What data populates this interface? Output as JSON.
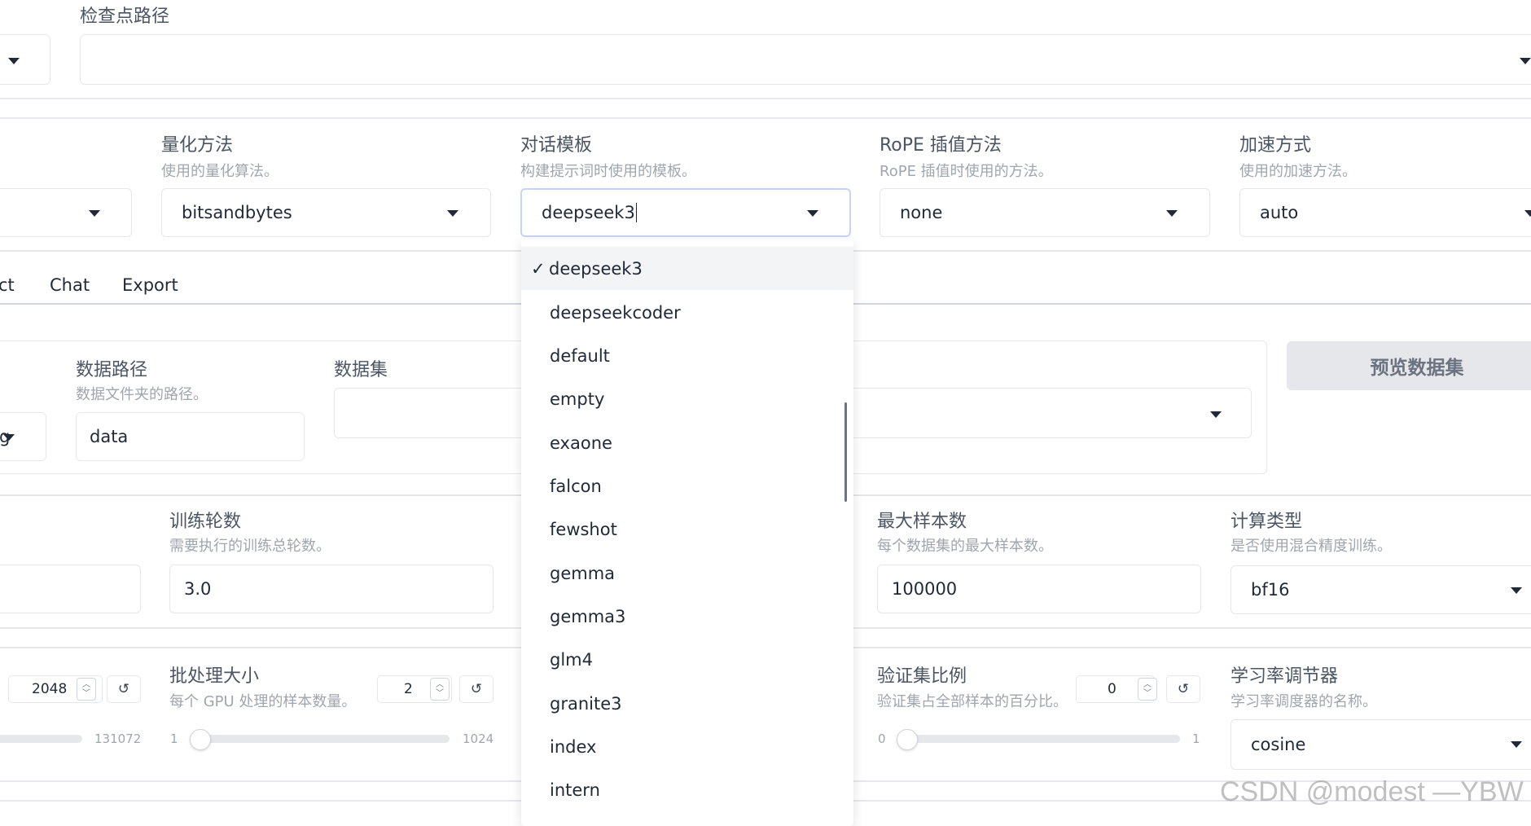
{
  "checkpoint": {
    "label": "检查点路径",
    "value": ""
  },
  "quantization": {
    "label": "量化方法",
    "hint": "使用的量化算法。",
    "value": "bitsandbytes"
  },
  "template": {
    "label": "对话模板",
    "hint": "构建提示词时使用的模板。",
    "value": "deepseek3"
  },
  "rope": {
    "label": "RoPE 插值方法",
    "hint": "RoPE 插值时使用的方法。",
    "value": "none"
  },
  "booster": {
    "label": "加速方式",
    "hint": "使用的加速方法。",
    "value": "auto"
  },
  "tabs": {
    "partial": "ct",
    "chat": "Chat",
    "export": "Export"
  },
  "dataset_dir": {
    "label": "数据路径",
    "hint": "数据文件夹的路径。",
    "value": "data"
  },
  "dataset": {
    "label": "数据集",
    "stage_partial": "g"
  },
  "preview_button": "预览数据集",
  "epochs": {
    "label": "训练轮数",
    "hint": "需要执行的训练总轮数。",
    "value": "3.0"
  },
  "left_hint_partial": "。",
  "max_samples": {
    "label": "最大样本数",
    "hint": "每个数据集的最大样本数。",
    "value": "100000"
  },
  "compute_type": {
    "label": "计算类型",
    "hint": "是否使用混合精度训练。",
    "value": "bf16"
  },
  "cutoff": {
    "value": "2048",
    "max_tick": "131072",
    "reset_icon": "↺"
  },
  "batch_size": {
    "label": "批处理大小",
    "hint": "每个 GPU 处理的样本数量。",
    "value": "2",
    "min_tick": "1",
    "max_tick": "1024",
    "level": 0.001,
    "reset_icon": "↺"
  },
  "val_size": {
    "label": "验证集比例",
    "hint": "验证集占全部样本的百分比。",
    "value": "0",
    "min_tick": "0",
    "max_tick": "1",
    "level": 0,
    "reset_icon": "↺"
  },
  "lr_scheduler": {
    "label": "学习率调节器",
    "hint": "学习率调度器的名称。",
    "value": "cosine"
  },
  "dropdown": {
    "check_mark": "✓",
    "options": [
      "deepseek3",
      "deepseekcoder",
      "default",
      "empty",
      "exaone",
      "falcon",
      "fewshot",
      "gemma",
      "gemma3",
      "glm4",
      "granite3",
      "index",
      "intern"
    ]
  },
  "watermark": "CSDN @modest —YBW"
}
